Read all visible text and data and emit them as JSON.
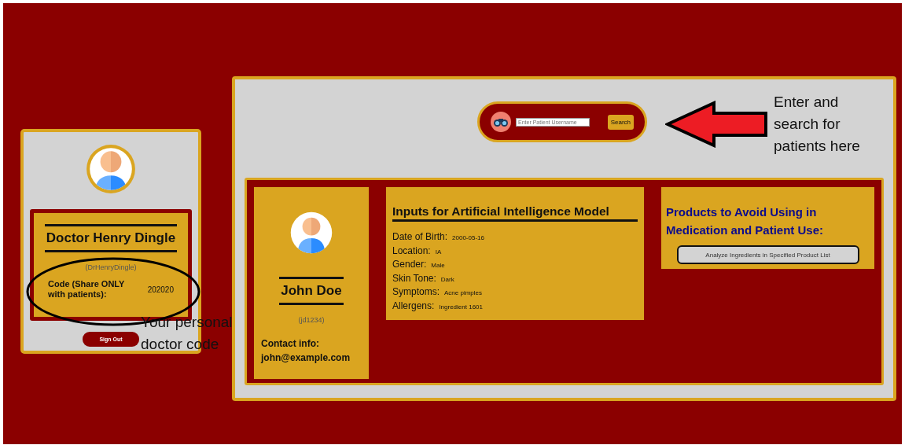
{
  "doctor": {
    "name": "Doctor Henry Dingle",
    "username": "(DrHenryDingle)",
    "code_label": "Code (Share ONLY with patients):",
    "code": "202020",
    "sign_out": "Sign Out"
  },
  "search": {
    "placeholder": "Enter Patient Username",
    "button": "Search"
  },
  "patient": {
    "name": "John Doe",
    "username": "(jd1234)",
    "contact_label": "Contact info:",
    "contact": "john@example.com"
  },
  "ai_inputs": {
    "title": "Inputs for Artificial Intelligence Model",
    "fields": [
      {
        "label": "Date of Birth:",
        "value": "2000-05-16"
      },
      {
        "label": "Location:",
        "value": "IA"
      },
      {
        "label": "Gender:",
        "value": "Male"
      },
      {
        "label": "Skin Tone:",
        "value": "Dark"
      },
      {
        "label": "Symptoms:",
        "value": "Acne pimples"
      },
      {
        "label": "Allergens:",
        "value": "Ingredient 1601"
      }
    ]
  },
  "products": {
    "title": "Products to Avoid Using in Medication and Patient Use:",
    "button": "Analyze Ingredients in Specified Product List"
  },
  "annotations": [
    {
      "kind": "arrow",
      "text": "Enter and search for patients here"
    },
    {
      "kind": "ellipse",
      "text": "Your personal doctor code"
    }
  ]
}
